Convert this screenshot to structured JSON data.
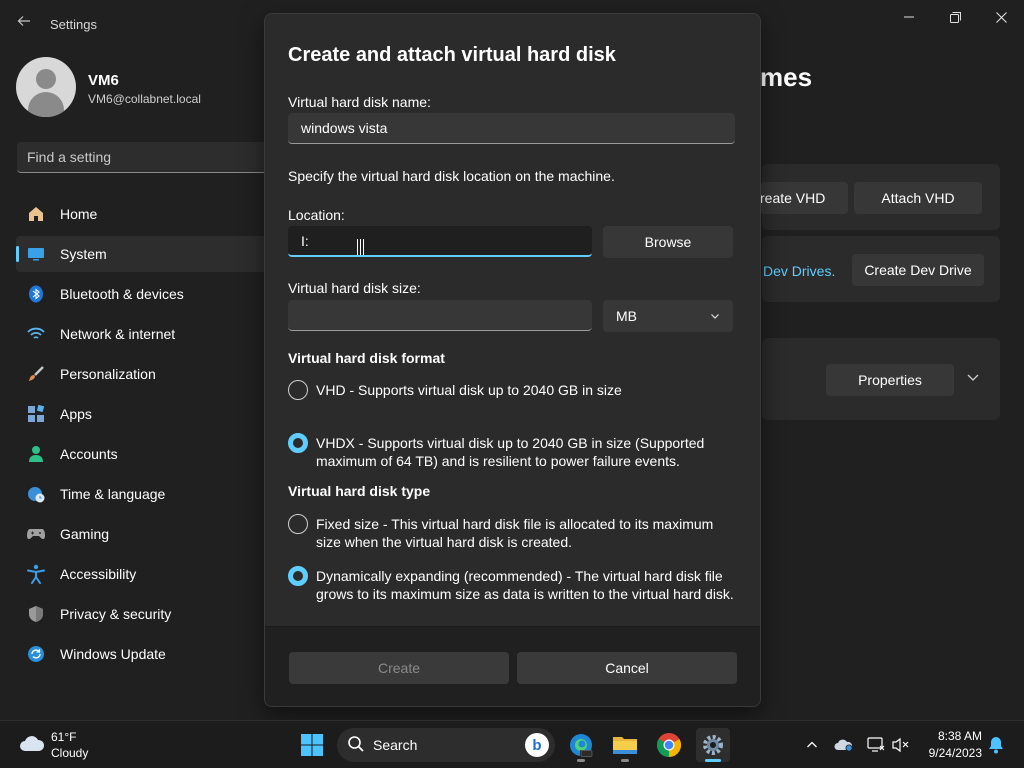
{
  "window": {
    "title": "Settings",
    "back_icon": "back-arrow-icon",
    "controls": [
      "minimize-icon",
      "maximize-icon",
      "close-icon"
    ]
  },
  "user": {
    "name": "VM6",
    "email": "VM6@collabnet.local"
  },
  "search": {
    "placeholder": "Find a setting"
  },
  "sidebar": {
    "items": [
      {
        "label": "Home",
        "icon": "home-icon",
        "color": "#e8c38e"
      },
      {
        "label": "System",
        "icon": "system-icon",
        "color": "#3aa0e8",
        "active": true
      },
      {
        "label": "Bluetooth & devices",
        "icon": "bluetooth-icon",
        "color": "#1f78d6"
      },
      {
        "label": "Network & internet",
        "icon": "wifi-icon",
        "color": "#58b7f0"
      },
      {
        "label": "Personalization",
        "icon": "brush-icon",
        "color": "#e08b5a"
      },
      {
        "label": "Apps",
        "icon": "apps-icon",
        "color": "#7aa6d8"
      },
      {
        "label": "Accounts",
        "icon": "accounts-icon",
        "color": "#2fbf8a"
      },
      {
        "label": "Time & language",
        "icon": "globe-clock-icon",
        "color": "#3a8fd8"
      },
      {
        "label": "Gaming",
        "icon": "gamepad-icon",
        "color": "#a0a0a0"
      },
      {
        "label": "Accessibility",
        "icon": "accessibility-icon",
        "color": "#3aa0e8"
      },
      {
        "label": "Privacy & security",
        "icon": "shield-icon",
        "color": "#9a9a9a"
      },
      {
        "label": "Windows Update",
        "icon": "update-icon",
        "color": "#2a8fd8"
      }
    ]
  },
  "background_page": {
    "title_partial": "mes",
    "create_vhd_partial": "reate VHD",
    "attach_vhd": "Attach VHD",
    "dev_drives_link_partial": "Dev Drives.",
    "create_dev_drive": "Create Dev Drive",
    "properties": "Properties"
  },
  "dialog": {
    "title": "Create and attach virtual hard disk",
    "name_label": "Virtual hard disk name:",
    "name_value": "windows vista",
    "location_description": "Specify the virtual hard disk location on the machine.",
    "location_label": "Location:",
    "location_value": "I:",
    "browse": "Browse",
    "size_label": "Virtual hard disk size:",
    "size_value": "",
    "size_unit": "MB",
    "format_heading": "Virtual hard disk format",
    "format_options": [
      {
        "label": "VHD - Supports virtual disk up to 2040 GB in size",
        "checked": false
      },
      {
        "label": "VHDX - Supports virtual disk up to 2040 GB in size (Supported maximum of 64 TB) and is resilient to power failure events.",
        "checked": true
      }
    ],
    "type_heading": "Virtual hard disk type",
    "type_options": [
      {
        "label": "Fixed size - This virtual hard disk file is allocated to its maximum size when the virtual hard disk is created.",
        "checked": false
      },
      {
        "label": "Dynamically expanding (recommended) - The virtual hard disk file grows to its maximum size as data is written to the virtual hard disk.",
        "checked": true
      }
    ],
    "create": "Create",
    "cancel": "Cancel"
  },
  "taskbar": {
    "weather": {
      "temp": "61°F",
      "desc": "Cloudy",
      "icon": "cloud-icon"
    },
    "search_label": "Search",
    "apps": [
      "start-icon",
      "search-icon",
      "edge-icon",
      "file-explorer-icon",
      "chrome-icon",
      "settings-icon"
    ],
    "tray": [
      "chevron-up-icon",
      "onedrive-icon",
      "network-icon",
      "volume-muted-icon",
      "notification-bell-icon"
    ],
    "time": "8:38 AM",
    "date": "9/24/2023"
  },
  "colors": {
    "accent": "#60cdff",
    "background": "#202020",
    "dialog": "#2b2b2b"
  }
}
